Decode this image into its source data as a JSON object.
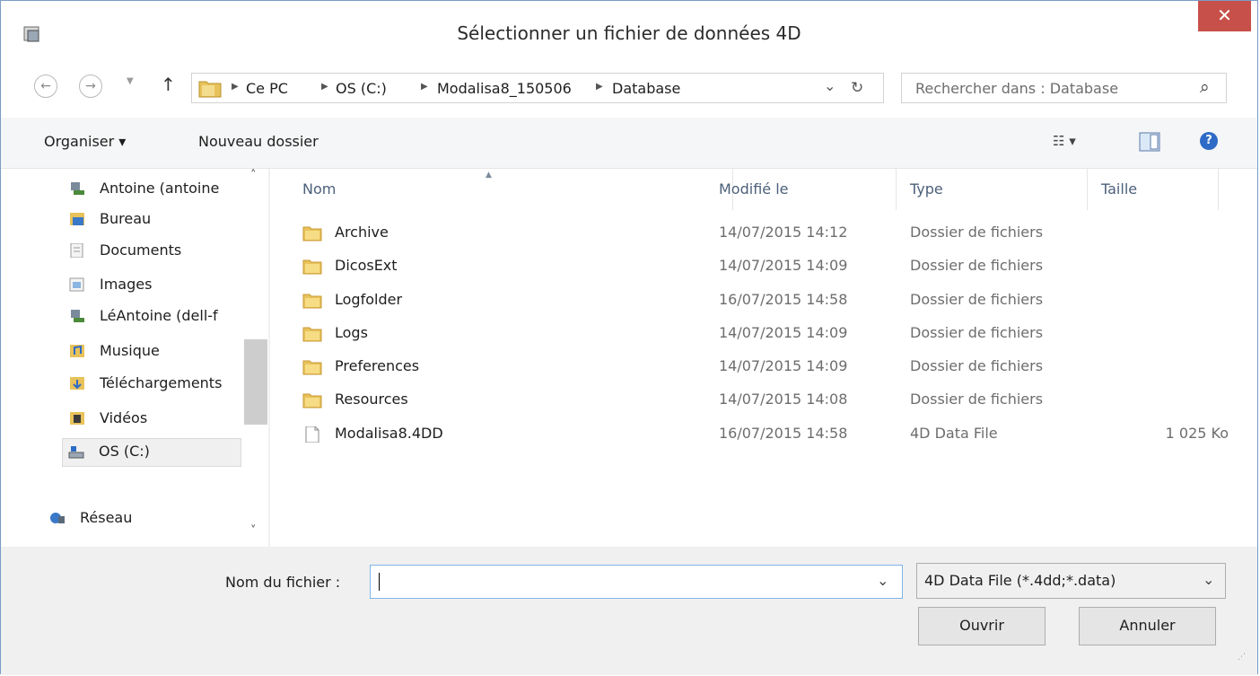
{
  "window": {
    "title": "Sélectionner un fichier de données 4D",
    "close_label": "✕"
  },
  "navigation": {
    "back_icon": "←",
    "forward_icon": "→",
    "up_icon": "↑",
    "breadcrumb": [
      "Ce PC",
      "OS (C:)",
      "Modalisa8_150506",
      "Database"
    ],
    "refresh_icon": "↻",
    "dropdown_icon": "⌄",
    "search_placeholder": "Rechercher dans : Database",
    "search_icon": "⌕"
  },
  "toolbar": {
    "organize_label": "Organiser ▾",
    "new_folder_label": "Nouveau dossier",
    "view_icon": "☷ ▾",
    "help_icon": "?"
  },
  "sidebar": {
    "items": [
      {
        "label": "Antoine (antoine",
        "icon": "network-user-icon"
      },
      {
        "label": "Bureau",
        "icon": "desktop-icon"
      },
      {
        "label": "Documents",
        "icon": "documents-icon"
      },
      {
        "label": "Images",
        "icon": "pictures-icon"
      },
      {
        "label": "LéAntoine (dell-f",
        "icon": "network-user-icon"
      },
      {
        "label": "Musique",
        "icon": "music-icon"
      },
      {
        "label": "Téléchargements",
        "icon": "downloads-icon"
      },
      {
        "label": "Vidéos",
        "icon": "videos-icon"
      },
      {
        "label": "OS (C:)",
        "icon": "drive-icon"
      }
    ],
    "network_label": "Réseau"
  },
  "file_list": {
    "columns": [
      "Nom",
      "Modifié le",
      "Type",
      "Taille"
    ],
    "rows": [
      {
        "name": "Archive",
        "date": "14/07/2015 14:12",
        "type": "Dossier de fichiers",
        "size": "",
        "kind": "folder"
      },
      {
        "name": "DicosExt",
        "date": "14/07/2015 14:09",
        "type": "Dossier de fichiers",
        "size": "",
        "kind": "folder"
      },
      {
        "name": "Logfolder",
        "date": "16/07/2015 14:58",
        "type": "Dossier de fichiers",
        "size": "",
        "kind": "folder"
      },
      {
        "name": "Logs",
        "date": "14/07/2015 14:09",
        "type": "Dossier de fichiers",
        "size": "",
        "kind": "folder"
      },
      {
        "name": "Preferences",
        "date": "14/07/2015 14:09",
        "type": "Dossier de fichiers",
        "size": "",
        "kind": "folder"
      },
      {
        "name": "Resources",
        "date": "14/07/2015 14:08",
        "type": "Dossier de fichiers",
        "size": "",
        "kind": "folder"
      },
      {
        "name": "Modalisa8.4DD",
        "date": "16/07/2015 14:58",
        "type": "4D Data File",
        "size": "1 025 Ko",
        "kind": "file"
      }
    ]
  },
  "bottom": {
    "filename_label": "Nom du fichier :",
    "filename_value": "",
    "filetype_value": "4D Data File (*.4dd;*.data)",
    "open_label": "Ouvrir",
    "cancel_label": "Annuler"
  },
  "colors": {
    "close_button": "#c7504a",
    "folder_yellow": "#e8c25a",
    "header_text": "#4c607a"
  }
}
